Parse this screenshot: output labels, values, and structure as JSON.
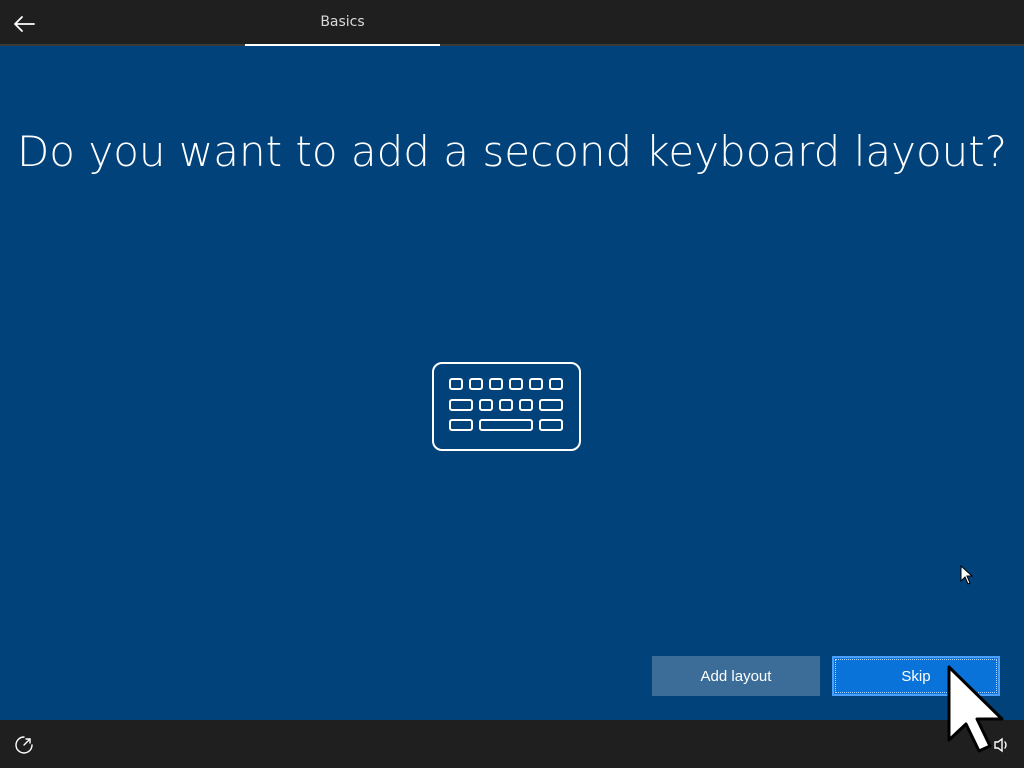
{
  "header": {
    "back_icon": "arrow-left-icon",
    "tab_label": "Basics"
  },
  "main": {
    "title": "Do you want to add a second keyboard layout?",
    "illustration_icon": "keyboard-icon"
  },
  "actions": {
    "add_label": "Add layout",
    "skip_label": "Skip"
  },
  "footer": {
    "left_icon": "ease-of-access-icon",
    "right_icon": "speaker-icon"
  },
  "colors": {
    "background": "#01427a",
    "bar": "#1f1f1f",
    "secondary_button": "#3b6d98",
    "primary_button": "#0a73d9"
  }
}
